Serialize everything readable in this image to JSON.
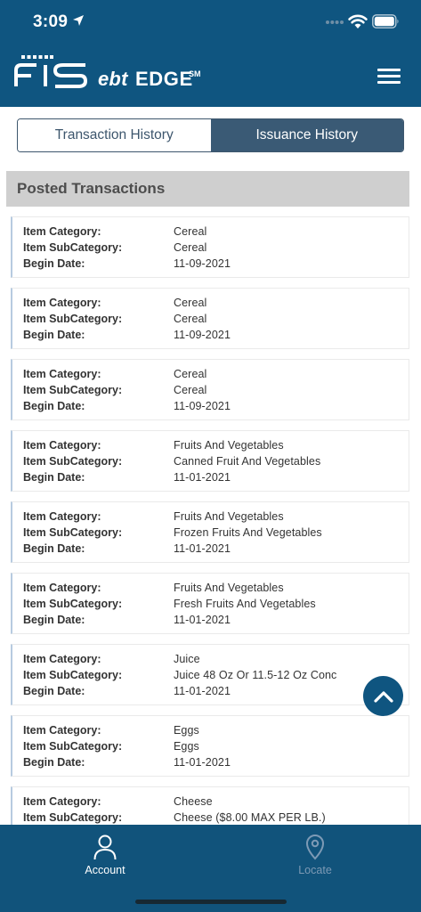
{
  "status": {
    "time": "3:09"
  },
  "header": {
    "logo_ebt": "ebt",
    "logo_edge": "EDGE",
    "logo_sm": "SM"
  },
  "tabs": [
    {
      "label": "Transaction History",
      "active": false
    },
    {
      "label": "Issuance History",
      "active": true
    }
  ],
  "section": {
    "title": "Posted Transactions"
  },
  "labels": {
    "category": "Item Category:",
    "subcategory": "Item SubCategory:",
    "begin_date": "Begin Date:"
  },
  "transactions": [
    {
      "category": "Cereal",
      "subcategory": "Cereal",
      "begin_date": "11-09-2021"
    },
    {
      "category": "Cereal",
      "subcategory": "Cereal",
      "begin_date": "11-09-2021"
    },
    {
      "category": "Cereal",
      "subcategory": "Cereal",
      "begin_date": "11-09-2021"
    },
    {
      "category": "Fruits And Vegetables",
      "subcategory": "Canned Fruit And Vegetables",
      "begin_date": "11-01-2021"
    },
    {
      "category": "Fruits And Vegetables",
      "subcategory": "Frozen Fruits And Vegetables",
      "begin_date": "11-01-2021"
    },
    {
      "category": "Fruits And Vegetables",
      "subcategory": "Fresh Fruits And Vegetables",
      "begin_date": "11-01-2021"
    },
    {
      "category": "Juice",
      "subcategory": "Juice 48 Oz Or 11.5-12 Oz Conc",
      "begin_date": "11-01-2021"
    },
    {
      "category": "Eggs",
      "subcategory": "Eggs",
      "begin_date": "11-01-2021"
    },
    {
      "category": "Cheese",
      "subcategory": "Cheese ($8.00 MAX PER LB.)",
      "begin_date": ""
    }
  ],
  "bottom_nav": [
    {
      "label": "Account",
      "icon": "person-icon",
      "active": true
    },
    {
      "label": "Locate",
      "icon": "location-pin-icon",
      "active": false
    }
  ],
  "colors": {
    "header_bg": "#0f5580",
    "tab_active": "#3a5a75",
    "section_bg": "#cfcfcf",
    "card_accent": "#b7cbe0"
  }
}
